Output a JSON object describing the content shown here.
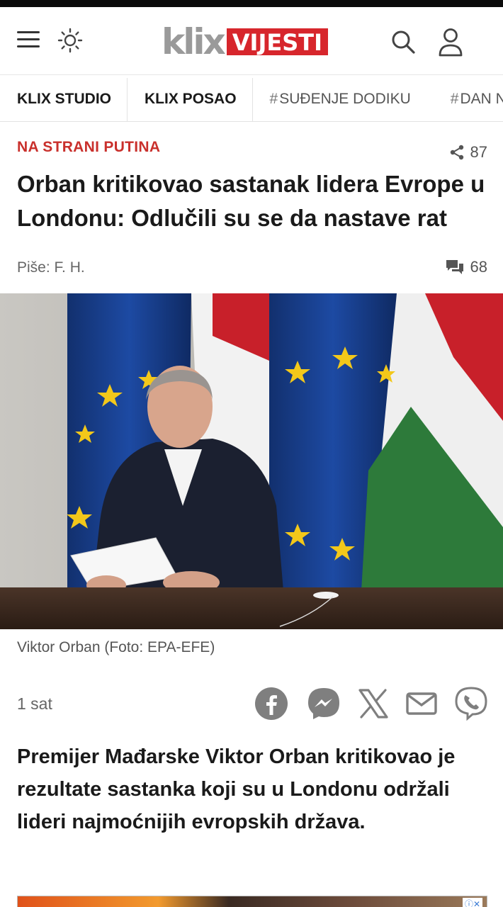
{
  "header": {
    "logo_klix": "klix",
    "logo_vijesti": "VIJESTI",
    "menu_icon": "hamburger-menu-icon",
    "theme_icon": "sun-icon",
    "search_icon": "search-icon",
    "user_icon": "user-icon",
    "brand_color": "#d7262c"
  },
  "tabs": [
    {
      "label": "KLIX STUDIO",
      "hash": ""
    },
    {
      "label": "KLIX POSAO",
      "hash": ""
    },
    {
      "label": "SUĐENJE DODIKU",
      "hash": "#"
    },
    {
      "label": "DAN NEZ",
      "hash": "#"
    }
  ],
  "article": {
    "kicker": "NA STRANI PUTINA",
    "shares": "87",
    "headline": "Orban kritikovao sastanak lidera Evrope u Londonu: Odlučili su se da nastave rat",
    "author": "Piše: F. H.",
    "comments": "68",
    "caption": "Viktor Orban (Foto: EPA-EFE)",
    "time": "1 sat",
    "lead": "Premijer Mađarske Viktor Orban kritikovao je rezultate sastanka koji su u Londonu održali lideri najmoćnijih evropskih država."
  },
  "share_icons": [
    "facebook-icon",
    "messenger-icon",
    "x-icon",
    "email-icon",
    "viber-icon"
  ]
}
